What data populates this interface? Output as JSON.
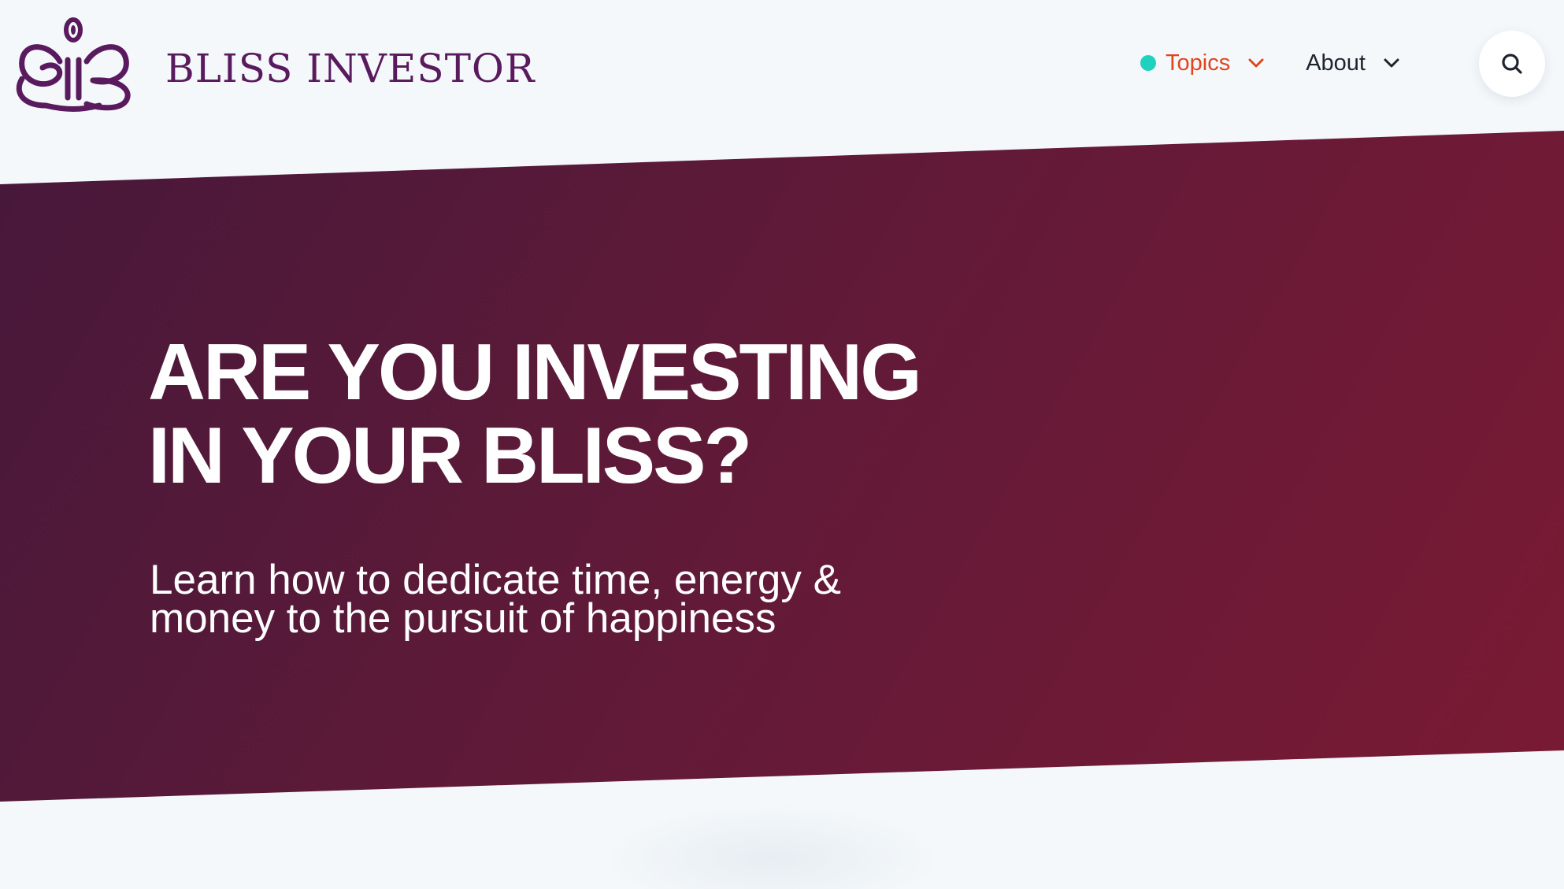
{
  "brand": {
    "name": "BLISS INVESTOR",
    "logo_icon": "bib-monogram-icon",
    "color": "#5a1b5e"
  },
  "nav": {
    "items": [
      {
        "label": "Topics",
        "active": true,
        "indicator_color": "#1fd1bf",
        "color": "#e0461e"
      },
      {
        "label": "About",
        "active": false,
        "color": "#1d2430"
      }
    ],
    "search_icon": "search-icon"
  },
  "hero": {
    "title_lines": [
      "ARE YOU INVESTING",
      "IN YOUR BLISS?"
    ],
    "subtitle_lines": [
      "Learn how to dedicate time, energy &",
      "money to the pursuit of happiness"
    ],
    "gradient_start": "#47183a",
    "gradient_end": "#7a1a34"
  }
}
